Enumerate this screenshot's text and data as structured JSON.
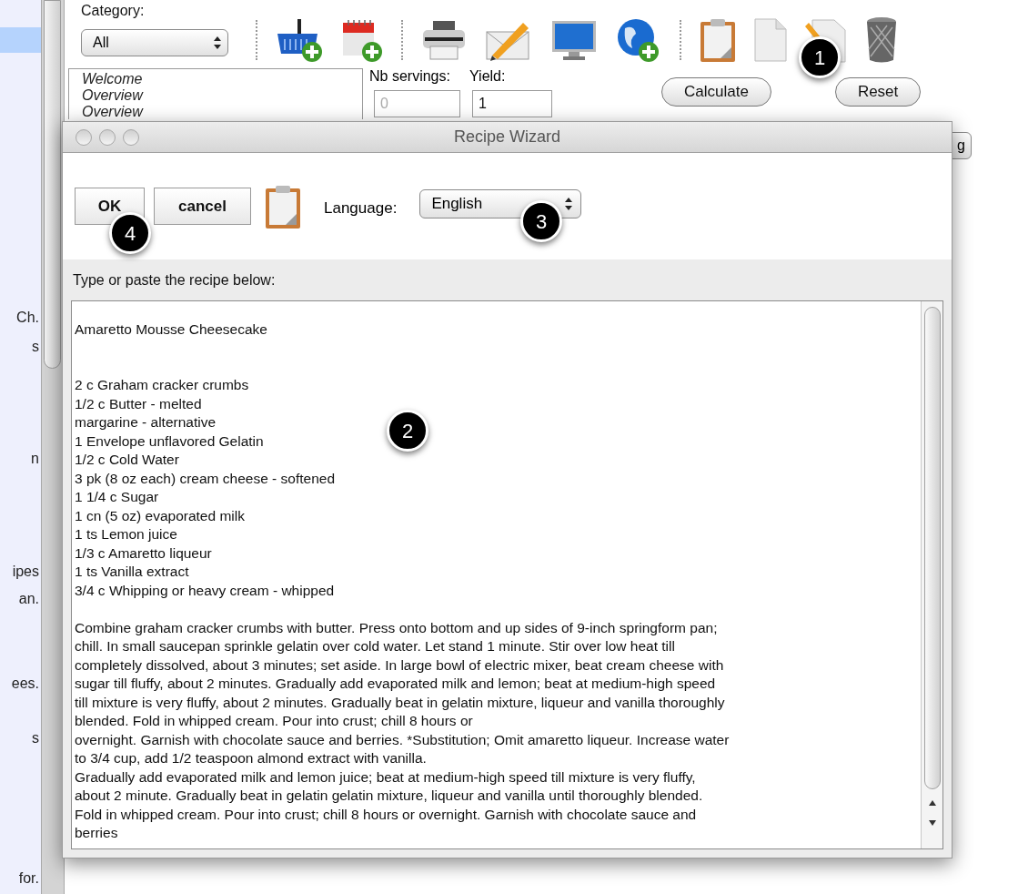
{
  "sidebar": {
    "fragments": [
      "Ch.",
      "s",
      "n",
      "ipes",
      "an.",
      "ees.",
      "s",
      "for."
    ]
  },
  "category": {
    "label": "Category:",
    "value": "All"
  },
  "sections_list": {
    "items": [
      "Welcome",
      "Overview",
      "Overview"
    ]
  },
  "servings": {
    "label": "Nb servings:",
    "value": "0",
    "disabled": true
  },
  "yield": {
    "label": "Yield:",
    "value": "1",
    "disabled": false
  },
  "buttons": [
    "Calculate",
    "Reset"
  ],
  "partial_button": "g",
  "dialog": {
    "title": "Recipe Wizard",
    "buttons": [
      "OK",
      "cancel"
    ],
    "language": {
      "label": "Language:",
      "value": "English"
    },
    "prompt": "Type or paste the recipe below:",
    "recipe_text": "\nAmaretto Mousse Cheesecake\n\n\n2 c Graham cracker crumbs\n1/2 c Butter - melted\nmargarine - alternative\n1 Envelope unflavored Gelatin\n1/2 c Cold Water\n3 pk (8 oz each) cream cheese - softened\n1 1/4 c Sugar\n1 cn (5 oz) evaporated milk\n1 ts Lemon juice\n1/3 c Amaretto liqueur\n1 ts Vanilla extract\n3/4 c Whipping or heavy cream - whipped\n\nCombine graham cracker crumbs with butter. Press onto bottom and up sides of 9-inch springform pan;\nchill. In small saucepan sprinkle gelatin over cold water. Let stand 1 minute. Stir over low heat till\ncompletely dissolved, about 3 minutes; set aside. In large bowl of electric mixer, beat cream cheese with\nsugar till fluffy, about 2 minutes. Gradually add evaporated milk and lemon; beat at medium-high speed\ntill mixture is very fluffy, about 2 minutes. Gradually beat in gelatin mixture, liqueur and vanilla thoroughly\nblended. Fold in whipped cream. Pour into crust; chill 8 hours or\novernight. Garnish with chocolate sauce and berries. *Substitution; Omit amaretto liqueur. Increase water\nto 3/4 cup, add 1/2 teaspoon almond extract with vanilla.\nGradually add evaporated milk and lemon juice; beat at medium-high speed till mixture is very fluffy,\nabout 2 minute. Gradually beat in gelatin gelatin mixture, liqueur and vanilla until thoroughly blended.\nFold in whipped cream. Pour into crust; chill 8 hours or overnight. Garnish with chocolate sauce and\nberries"
  },
  "callouts": [
    "1",
    "2",
    "3",
    "4"
  ]
}
